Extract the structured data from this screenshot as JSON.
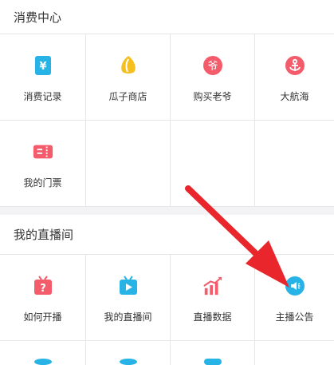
{
  "consumption_center": {
    "title": "消费中心",
    "items": [
      {
        "label": "消费记录",
        "icon": "yen-receipt-icon",
        "color": "#27b3e6"
      },
      {
        "label": "瓜子商店",
        "icon": "seed-icon",
        "color": "#f5bf1f"
      },
      {
        "label": "购买老爷",
        "icon": "ye-badge-icon",
        "color": "#f45b6b"
      },
      {
        "label": "大航海",
        "icon": "anchor-icon",
        "color": "#f45b6b"
      },
      {
        "label": "我的门票",
        "icon": "ticket-icon",
        "color": "#f45b6b"
      }
    ]
  },
  "my_live_room": {
    "title": "我的直播间",
    "items": [
      {
        "label": "如何开播",
        "icon": "tv-question-icon",
        "color": "#f45b6b"
      },
      {
        "label": "我的直播间",
        "icon": "tv-play-icon",
        "color": "#27b3e6"
      },
      {
        "label": "直播数据",
        "icon": "bar-chart-icon",
        "color": "#f45b6b"
      },
      {
        "label": "主播公告",
        "icon": "speaker-icon",
        "color": "#27b3e6"
      }
    ]
  },
  "annotation": {
    "color": "#e8262b"
  }
}
